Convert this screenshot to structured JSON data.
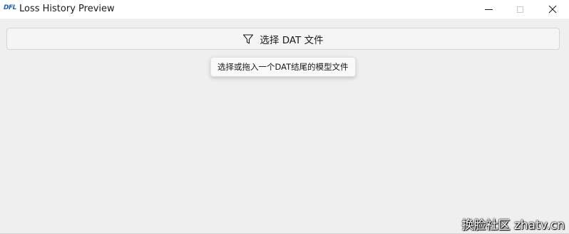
{
  "window": {
    "title": "Loss History Preview",
    "logo_text": "DFL"
  },
  "controls": {
    "minimize_icon": "minimize-icon",
    "maximize_icon": "maximize-icon",
    "close_icon": "close-icon"
  },
  "toolbar": {
    "select_button_label": "选择 DAT 文件",
    "select_button_icon": "filter-icon",
    "tooltip": "选择或拖入一个DAT结尾的模型文件"
  },
  "watermark": {
    "text": "换脸社区 zhatv.cn"
  },
  "colors": {
    "background": "#efefef",
    "titlebar": "#ffffff",
    "logo": "#1f5fbf"
  }
}
